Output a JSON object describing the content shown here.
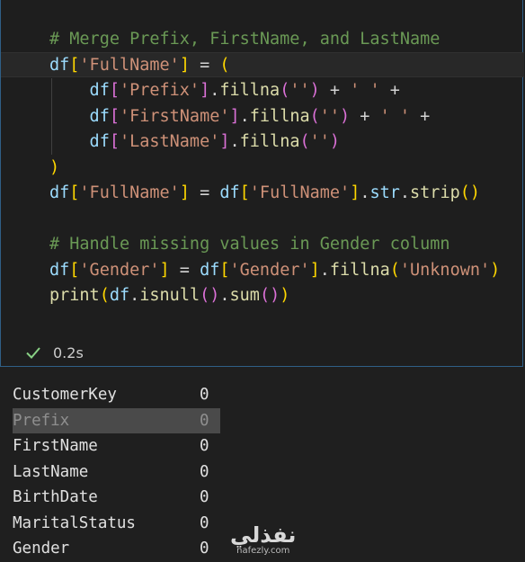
{
  "code": {
    "lines": [
      [
        {
          "t": "# Merge Prefix, FirstName, and LastName",
          "c": "c-com"
        }
      ],
      [
        {
          "t": "df",
          "c": "c-var"
        },
        {
          "t": "[",
          "c": "c-br1"
        },
        {
          "t": "'FullName'",
          "c": "c-str"
        },
        {
          "t": "]",
          "c": "c-br1"
        },
        {
          "t": " = ",
          "c": "c-op"
        },
        {
          "t": "(",
          "c": "c-br1"
        }
      ],
      [
        {
          "t": "    df",
          "c": "c-var"
        },
        {
          "t": "[",
          "c": "c-br2"
        },
        {
          "t": "'Prefix'",
          "c": "c-str"
        },
        {
          "t": "]",
          "c": "c-br2"
        },
        {
          "t": ".",
          "c": "c-op"
        },
        {
          "t": "fillna",
          "c": "c-fn"
        },
        {
          "t": "(",
          "c": "c-br2"
        },
        {
          "t": "''",
          "c": "c-str"
        },
        {
          "t": ")",
          "c": "c-br2"
        },
        {
          "t": " + ",
          "c": "c-op"
        },
        {
          "t": "' '",
          "c": "c-str"
        },
        {
          "t": " +",
          "c": "c-op"
        }
      ],
      [
        {
          "t": "    df",
          "c": "c-var"
        },
        {
          "t": "[",
          "c": "c-br2"
        },
        {
          "t": "'FirstName'",
          "c": "c-str"
        },
        {
          "t": "]",
          "c": "c-br2"
        },
        {
          "t": ".",
          "c": "c-op"
        },
        {
          "t": "fillna",
          "c": "c-fn"
        },
        {
          "t": "(",
          "c": "c-br2"
        },
        {
          "t": "''",
          "c": "c-str"
        },
        {
          "t": ")",
          "c": "c-br2"
        },
        {
          "t": " + ",
          "c": "c-op"
        },
        {
          "t": "' '",
          "c": "c-str"
        },
        {
          "t": " +",
          "c": "c-op"
        }
      ],
      [
        {
          "t": "    df",
          "c": "c-var"
        },
        {
          "t": "[",
          "c": "c-br2"
        },
        {
          "t": "'LastName'",
          "c": "c-str"
        },
        {
          "t": "]",
          "c": "c-br2"
        },
        {
          "t": ".",
          "c": "c-op"
        },
        {
          "t": "fillna",
          "c": "c-fn"
        },
        {
          "t": "(",
          "c": "c-br2"
        },
        {
          "t": "''",
          "c": "c-str"
        },
        {
          "t": ")",
          "c": "c-br2"
        }
      ],
      [
        {
          "t": ")",
          "c": "c-br1"
        }
      ],
      [
        {
          "t": "df",
          "c": "c-var"
        },
        {
          "t": "[",
          "c": "c-br1"
        },
        {
          "t": "'FullName'",
          "c": "c-str"
        },
        {
          "t": "]",
          "c": "c-br1"
        },
        {
          "t": " = ",
          "c": "c-op"
        },
        {
          "t": "df",
          "c": "c-var"
        },
        {
          "t": "[",
          "c": "c-br1"
        },
        {
          "t": "'FullName'",
          "c": "c-str"
        },
        {
          "t": "]",
          "c": "c-br1"
        },
        {
          "t": ".",
          "c": "c-op"
        },
        {
          "t": "str",
          "c": "c-var"
        },
        {
          "t": ".",
          "c": "c-op"
        },
        {
          "t": "strip",
          "c": "c-fn"
        },
        {
          "t": "()",
          "c": "c-br1"
        }
      ],
      [],
      [
        {
          "t": "# Handle missing values in Gender column",
          "c": "c-com"
        }
      ],
      [
        {
          "t": "df",
          "c": "c-var"
        },
        {
          "t": "[",
          "c": "c-br1"
        },
        {
          "t": "'Gender'",
          "c": "c-str"
        },
        {
          "t": "]",
          "c": "c-br1"
        },
        {
          "t": " = ",
          "c": "c-op"
        },
        {
          "t": "df",
          "c": "c-var"
        },
        {
          "t": "[",
          "c": "c-br1"
        },
        {
          "t": "'Gender'",
          "c": "c-str"
        },
        {
          "t": "]",
          "c": "c-br1"
        },
        {
          "t": ".",
          "c": "c-op"
        },
        {
          "t": "fillna",
          "c": "c-fn"
        },
        {
          "t": "(",
          "c": "c-br1"
        },
        {
          "t": "'Unknown'",
          "c": "c-str"
        },
        {
          "t": ")",
          "c": "c-br1"
        }
      ],
      [
        {
          "t": "print",
          "c": "c-fn"
        },
        {
          "t": "(",
          "c": "c-br1"
        },
        {
          "t": "df",
          "c": "c-var"
        },
        {
          "t": ".",
          "c": "c-op"
        },
        {
          "t": "isnull",
          "c": "c-fn"
        },
        {
          "t": "(",
          "c": "c-br2"
        },
        {
          "t": ")",
          "c": "c-br2"
        },
        {
          "t": ".",
          "c": "c-op"
        },
        {
          "t": "sum",
          "c": "c-fn"
        },
        {
          "t": "(",
          "c": "c-br2"
        },
        {
          "t": ")",
          "c": "c-br2"
        },
        {
          "t": ")",
          "c": "c-br1"
        }
      ]
    ]
  },
  "status": {
    "icon": "check-icon",
    "duration": "0.2s",
    "color": "#89d185"
  },
  "output": {
    "rows": [
      {
        "key": "CustomerKey",
        "value": "0"
      },
      {
        "key": "Prefix",
        "value": "0",
        "highlighted": true
      },
      {
        "key": "FirstName",
        "value": "0"
      },
      {
        "key": "LastName",
        "value": "0"
      },
      {
        "key": "BirthDate",
        "value": "0"
      },
      {
        "key": "MaritalStatus",
        "value": "0"
      },
      {
        "key": "Gender",
        "value": "0"
      }
    ]
  },
  "watermark": {
    "logo": "نفذلي",
    "url": "nafezly.com"
  }
}
